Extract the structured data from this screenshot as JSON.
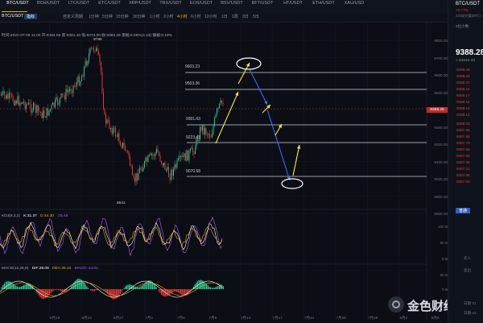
{
  "tabs": [
    {
      "label": "BTC/USDT",
      "active": true
    },
    {
      "label": "BCH/USDT",
      "active": false
    },
    {
      "label": "LTC/USDT",
      "active": false
    },
    {
      "label": "ETC/USDT",
      "active": false
    },
    {
      "label": "XRP/USDT",
      "active": false
    },
    {
      "label": "TRX/USDT",
      "active": false
    },
    {
      "label": "EOS/USDT",
      "active": false
    },
    {
      "label": "BSV/USDT",
      "active": false
    },
    {
      "label": "BFT/USDT",
      "active": false
    },
    {
      "label": "HT/USDT",
      "active": false
    },
    {
      "label": "ETH/USDT",
      "active": false
    },
    {
      "label": "XAU/USD",
      "active": false
    }
  ],
  "toolbar": {
    "pair_title": "BTC/USDT",
    "pair_sub": "Binance",
    "indicators_btn": "指标",
    "custom_btn": "自定义周期",
    "timeframes": [
      "1分钟",
      "5分钟",
      "15分钟",
      "30分钟",
      "1小时",
      "2小时",
      "4小时",
      "6小时",
      "12小时",
      "1日",
      "1周",
      "3日",
      "5日"
    ],
    "active_timeframe": "4小时"
  },
  "ohlc_line": "时间:2020-07-09 11:00  开:9384.06  高:9391.10  低:9373.00  收:9388.29  涨幅:0.05%(4.23)  振幅:0.19%",
  "price_axis": [
    "9800.00",
    "9700.00",
    "9600.00",
    "9500.00",
    "9400.00",
    "9300.00",
    "9200.00",
    "9100.00",
    "9000.00",
    "8900.00",
    "8800.00"
  ],
  "current_price_tag": "9388.29",
  "annotations": {
    "high_label": "9785",
    "low_label": "8841",
    "h_levels": [
      "9603.23",
      "9503.36",
      "9301.63",
      "9223.43",
      "9070.68"
    ]
  },
  "kdj": {
    "title": "KDJ(9,3,3)",
    "k": "K:31.37",
    "d": "D:44.30",
    "j": "J:5.49",
    "axis": [
      "100.00",
      "50.00",
      "0.00"
    ]
  },
  "macd": {
    "title": "MACD(12,26,9)",
    "dif": "DIF:29.09",
    "dea": "DEA:36.10",
    "macd": "MACD:-14.01",
    "axis": [
      "50.00",
      "0.00",
      "-50.00"
    ]
  },
  "date_axis": [
    "6月19",
    "6月23",
    "6月27",
    "7月1",
    "7月5",
    "7月9",
    "7月13",
    "7月17",
    "7月21",
    "7月25",
    "7月29",
    "8月2",
    "8月6"
  ],
  "right_panel": {
    "pair": "BTC/USDT",
    "change": "+0.77%",
    "sub": "24h成交量(BTC)",
    "price": "9388.28",
    "cny": "≈ 63342.43",
    "depth_label": "2位小数",
    "asks": [
      "9388.29",
      "9388.26",
      "9388.20",
      "9388.19",
      "9388.17",
      "9388.16",
      "9388.14",
      "9388.12"
    ],
    "bids": [
      "9388.03",
      "9387.98",
      "9387.88",
      "9387.79",
      "9387.66",
      "9387.58",
      "9387.39",
      "9387.21",
      "9387.05",
      "9387.00"
    ],
    "tab_label": "普通",
    "side_labels": [
      "买入",
      "卖出"
    ],
    "bottom_labels": [
      "日期 01",
      "日期 02"
    ]
  },
  "watermark": "金色财经",
  "colors": {
    "up": "#20c997",
    "down": "#e53935",
    "accent": "#f0b400",
    "yellow_arrow": "#ffee33",
    "blue_arrow": "#3a6cf4",
    "kline_k": "#ffffff",
    "kline_d": "#f0b400",
    "kline_j": "#c05cff"
  }
}
